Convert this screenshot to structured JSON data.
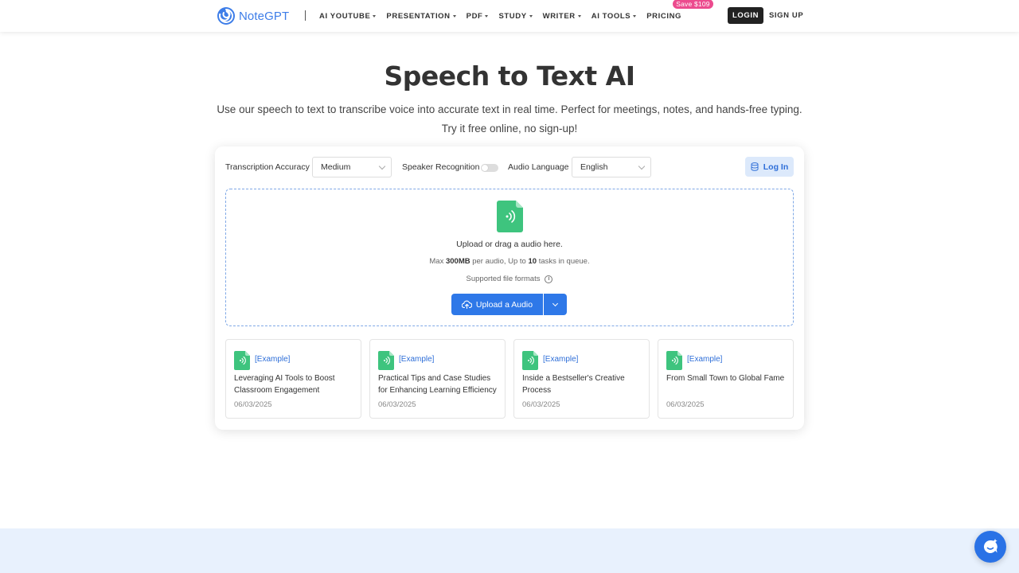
{
  "header": {
    "logo_text": "NoteGPT",
    "nav": [
      {
        "label": "AI YOUTUBE"
      },
      {
        "label": "PRESENTATION"
      },
      {
        "label": "PDF"
      },
      {
        "label": "STUDY"
      },
      {
        "label": "WRITER"
      },
      {
        "label": "AI TOOLS"
      }
    ],
    "pricing": "PRICING",
    "save_badge": "Save $109",
    "login": "LOGIN",
    "signup": "SIGN UP"
  },
  "hero": {
    "title": "Speech to Text AI",
    "subtitle": "Use our speech to text to transcribe voice into accurate text in real time. Perfect for meetings, notes, and hands-free typing. Try it free online, no sign-up!"
  },
  "options": {
    "accuracy_label": "Transcription Accuracy",
    "accuracy_value": "Medium",
    "speaker_label": "Speaker Recognition",
    "speaker_enabled": false,
    "language_label": "Audio Language",
    "language_value": "English",
    "login_label": "Log In"
  },
  "dropzone": {
    "main_text": "Upload or drag a audio here.",
    "max_prefix": "Max ",
    "max_size": "300MB",
    "max_mid": " per audio, Up to ",
    "max_tasks": "10",
    "max_suffix": " tasks in queue.",
    "formats_text": "Supported file formats",
    "upload_label": "Upload a Audio"
  },
  "examples": [
    {
      "tag": "[Example]",
      "title": "Leveraging AI Tools to Boost Classroom Engagement",
      "date": "06/03/2025"
    },
    {
      "tag": "[Example]",
      "title": "Practical Tips and Case Studies for Enhancing Learning Efficiency",
      "date": "06/03/2025"
    },
    {
      "tag": "[Example]",
      "title": "Inside a Bestseller's Creative Process",
      "date": "06/03/2025"
    },
    {
      "tag": "[Example]",
      "title": "From Small Town to Global Fame",
      "date": "06/03/2025"
    }
  ],
  "colors": {
    "brand": "#3d7de8",
    "primary_button": "#2e78e8",
    "audio_icon": "#3ec47e",
    "save_badge": "#ec4b8e"
  }
}
